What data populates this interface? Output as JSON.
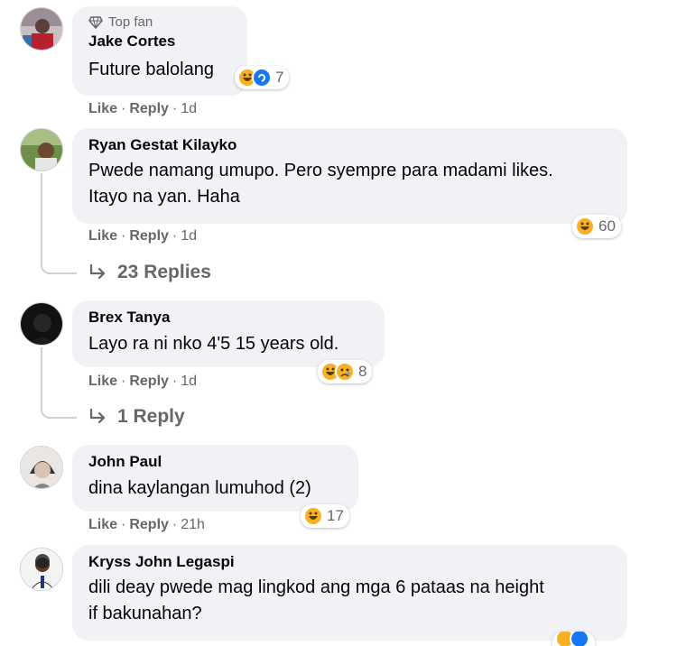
{
  "comments": [
    {
      "badge": "Top fan",
      "name": "Jake Cortes",
      "text": "Future balolang",
      "like": "Like",
      "reply": "Reply",
      "time": "1d",
      "reaction_count": "7",
      "reactions": [
        "haha-icon",
        "care-icon"
      ]
    },
    {
      "name": "Ryan Gestat Kilayko",
      "text_line1": "Pwede namang umupo. Pero syempre para madami likes.",
      "text_line2": "Itayo na yan. Haha",
      "like": "Like",
      "reply": "Reply",
      "time": "1d",
      "reaction_count": "60",
      "reactions": [
        "haha-icon"
      ],
      "replies_label": "23 Replies"
    },
    {
      "name": "Brex Tanya",
      "text": "Layo ra ni nko 4'5 15 years old.",
      "like": "Like",
      "reply": "Reply",
      "time": "1d",
      "reaction_count": "8",
      "reactions": [
        "haha-icon",
        "sad-icon"
      ],
      "replies_label": "1 Reply"
    },
    {
      "name": "John Paul",
      "text": "dina kaylangan lumuhod (2)",
      "like": "Like",
      "reply": "Reply",
      "time": "21h",
      "reaction_count": "17",
      "reactions": [
        "haha-icon"
      ]
    },
    {
      "name": "Kryss John Legaspi",
      "text_line1": "dili deay pwede mag lingkod ang mga 6 pataas na height",
      "text_line2": "if bakunahan?",
      "reactions": [
        "haha-icon",
        "care-icon"
      ]
    }
  ],
  "colors": {
    "bubble": "#f0f2f5",
    "secondary_text": "#65676b",
    "haha_yellow": "#f7b125",
    "like_blue": "#1877f2"
  }
}
